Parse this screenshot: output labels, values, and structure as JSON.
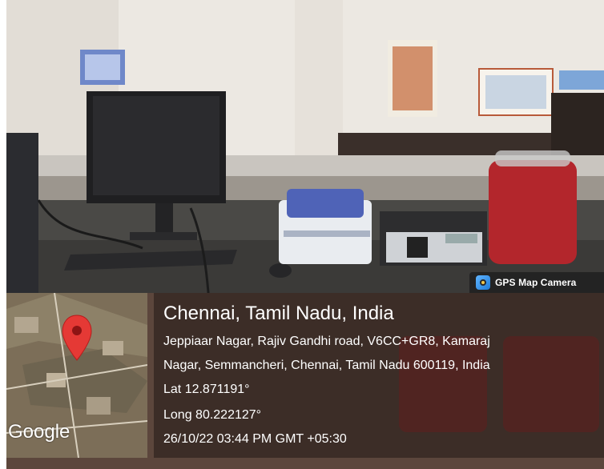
{
  "badge": {
    "label": "GPS Map Camera",
    "icon": "gps-map-camera-app-icon"
  },
  "location": {
    "title": "Chennai, Tamil Nadu, India",
    "address_line1": "Jeppiaar Nagar, Rajiv Gandhi road, V6CC+GR8, Kamaraj",
    "address_line2": "Nagar, Semmancheri, Chennai, Tamil Nadu 600119, India",
    "lat": "Lat 12.871191°",
    "long": "Long 80.222127°",
    "datetime": "26/10/22 03:44 PM GMT +05:30"
  },
  "map": {
    "logo_text": "Google",
    "pin_color": "#e53935"
  }
}
